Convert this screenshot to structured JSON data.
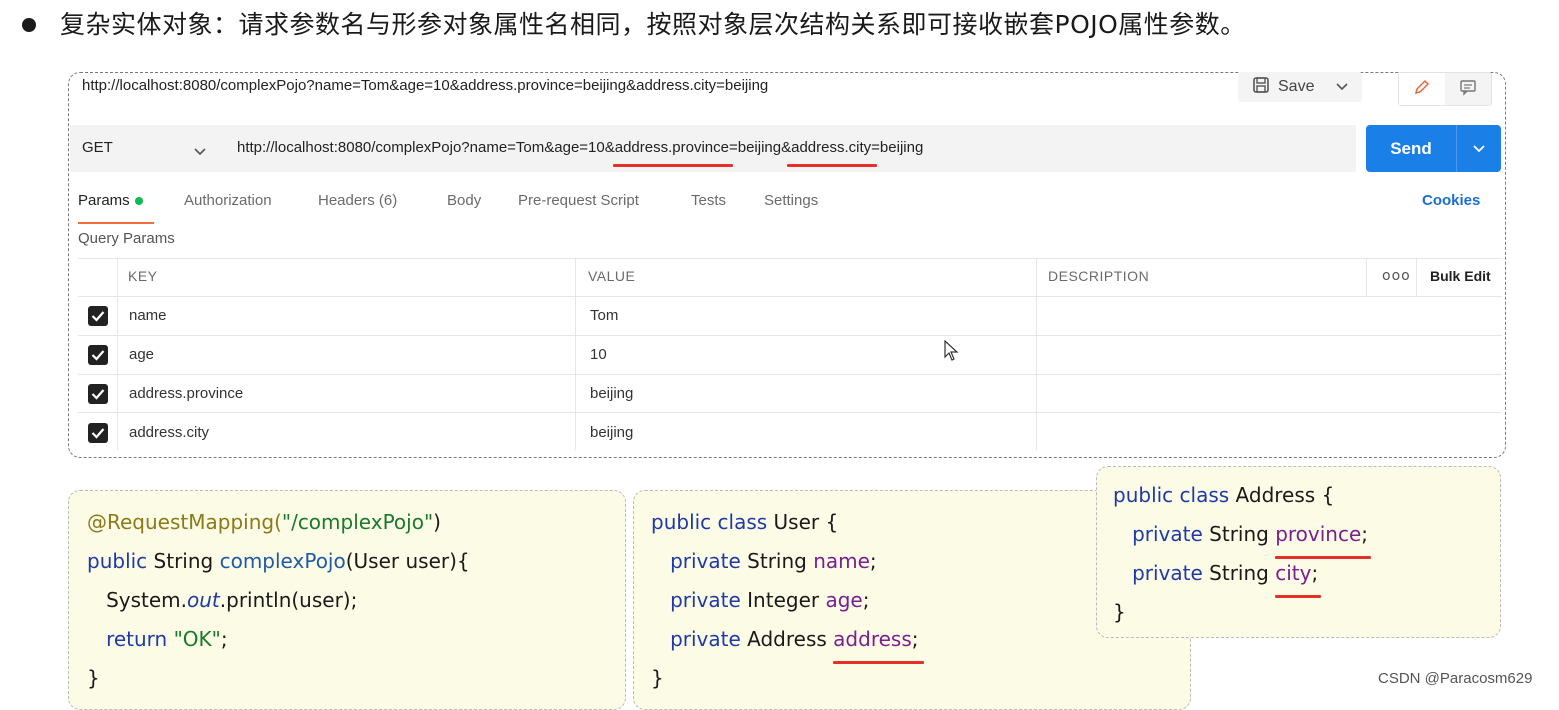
{
  "heading": "复杂实体对象：请求参数名与形参对象属性名相同，按照对象层次结构关系即可接收嵌套POJO属性参数。",
  "postman": {
    "title_url": "http://localhost:8080/complexPojo?name=Tom&age=10&address.province=beijing&address.city=beijing",
    "save_label": "Save",
    "method": "GET",
    "url_parts": {
      "p1": "http://localhost:8080/complexPojo?name=Tom&age=10&",
      "p2": "address.province",
      "p3": "=beijing&",
      "p4": "address.city",
      "p5": "=beijing"
    },
    "send_label": "Send",
    "tabs": {
      "params": "Params",
      "authorization": "Authorization",
      "headers": "Headers (6)",
      "body": "Body",
      "prerequest": "Pre-request Script",
      "tests": "Tests",
      "settings": "Settings"
    },
    "cookies": "Cookies",
    "query_params_label": "Query Params",
    "columns": {
      "key": "KEY",
      "value": "VALUE",
      "description": "DESCRIPTION",
      "more": "ooo",
      "bulk_edit": "Bulk Edit"
    },
    "rows": [
      {
        "key": "name",
        "value": "Tom",
        "checked": true
      },
      {
        "key": "age",
        "value": "10",
        "checked": true
      },
      {
        "key": "address.province",
        "value": "beijing",
        "checked": true
      },
      {
        "key": "address.city",
        "value": "beijing",
        "checked": true
      }
    ]
  },
  "code": {
    "controller": {
      "l1_ann": "@RequestMapping(",
      "l1_str": "\"/complexPojo\"",
      "l1_end": ")",
      "l2_kw": "public",
      "l2_type": " String ",
      "l2_fn": "complexPojo",
      "l2_rest": "(User user){",
      "l3_a": "System.",
      "l3_b": "out",
      "l3_c": ".println(user);",
      "l4_kw": "return",
      "l4_str": " \"OK\"",
      "l4_end": ";",
      "l5": "}"
    },
    "user": {
      "l1_kw": "public class",
      "l1_rest": " User {",
      "l2_kw": "private",
      "l2_type": " String ",
      "l2_fld": "name",
      "l3_kw": "private",
      "l3_type": " Integer ",
      "l3_fld": "age",
      "l4_kw": "private",
      "l4_type": " Address ",
      "l4_fld": "address",
      "l5": "}",
      "semi": ";"
    },
    "address": {
      "l1_kw": "public class",
      "l1_rest": " Address {",
      "l2_kw": "private",
      "l2_type": " String ",
      "l2_fld": "province",
      "l3_kw": "private",
      "l3_type": " String ",
      "l3_fld": "city",
      "l4": "}",
      "semi": ";"
    }
  },
  "watermark": "CSDN @Paracosm629",
  "colors": {
    "send": "#1b7fe8",
    "underline": "#e5302a",
    "code_bg": "#fcfbe6",
    "params_dot": "#0cbb52"
  }
}
